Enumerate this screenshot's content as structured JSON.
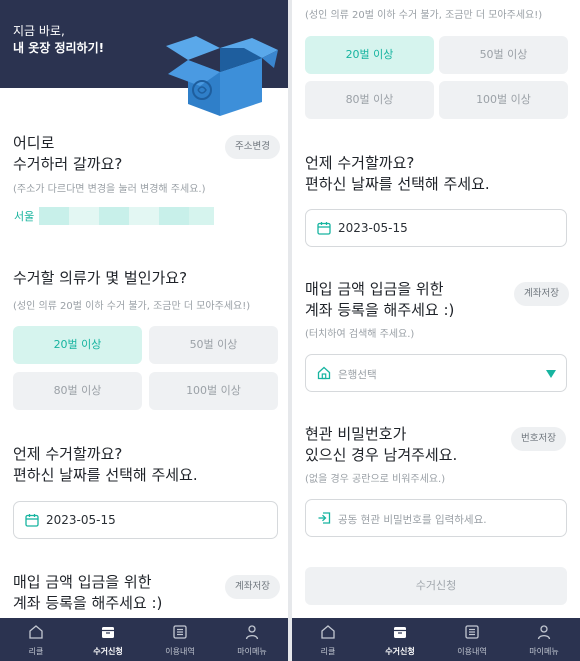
{
  "banner": {
    "line1": "지금 바로,",
    "line2": "내 옷장 정리하기!"
  },
  "address": {
    "title_line1": "어디로",
    "title_line2": "수거하러 갈까요?",
    "change_button": "주소변경",
    "hint": "(주소가 다르다면 변경을 눌러 변경해 주세요.)",
    "city": "서울"
  },
  "quantity": {
    "title": "수거할 의류가 몇 벌인가요?",
    "hint": "(성인 의류 20벌 이하 수거 불가, 조금만 더 모아주세요!)",
    "options": [
      "20벌 이상",
      "50벌 이상",
      "80벌 이상",
      "100벌 이상"
    ],
    "selected": "20벌 이상"
  },
  "schedule": {
    "title_line1": "언제 수거할까요?",
    "title_line2": "편하신 날짜를 선택해 주세요.",
    "date": "2023-05-15"
  },
  "account": {
    "title_line1": "매입 금액 입금을 위한",
    "title_line2": "계좌 등록을 해주세요 :)",
    "save_button": "계좌저장",
    "hint": "(터치하여 검색해 주세요.)",
    "bank_placeholder": "은행선택"
  },
  "password": {
    "title_line1": "현관 비밀번호가",
    "title_line2": "있으신 경우 남겨주세요.",
    "save_button": "번호저장",
    "hint": "(없을 경우 공란으로 비워주세요.)",
    "placeholder": "공동 현관 비밀번호를 입력하세요."
  },
  "submit_label": "수거신청",
  "tabs": [
    {
      "label": "리클",
      "icon": "home-icon"
    },
    {
      "label": "수거신청",
      "icon": "box-icon"
    },
    {
      "label": "이용내역",
      "icon": "list-icon"
    },
    {
      "label": "마이메뉴",
      "icon": "person-icon"
    }
  ],
  "active_tab": "수거신청",
  "colors": {
    "navy": "#2b3350",
    "accent": "#17b4a0",
    "selected_bg": "#d6f4ee",
    "box_blue": "#3d8fd9"
  }
}
